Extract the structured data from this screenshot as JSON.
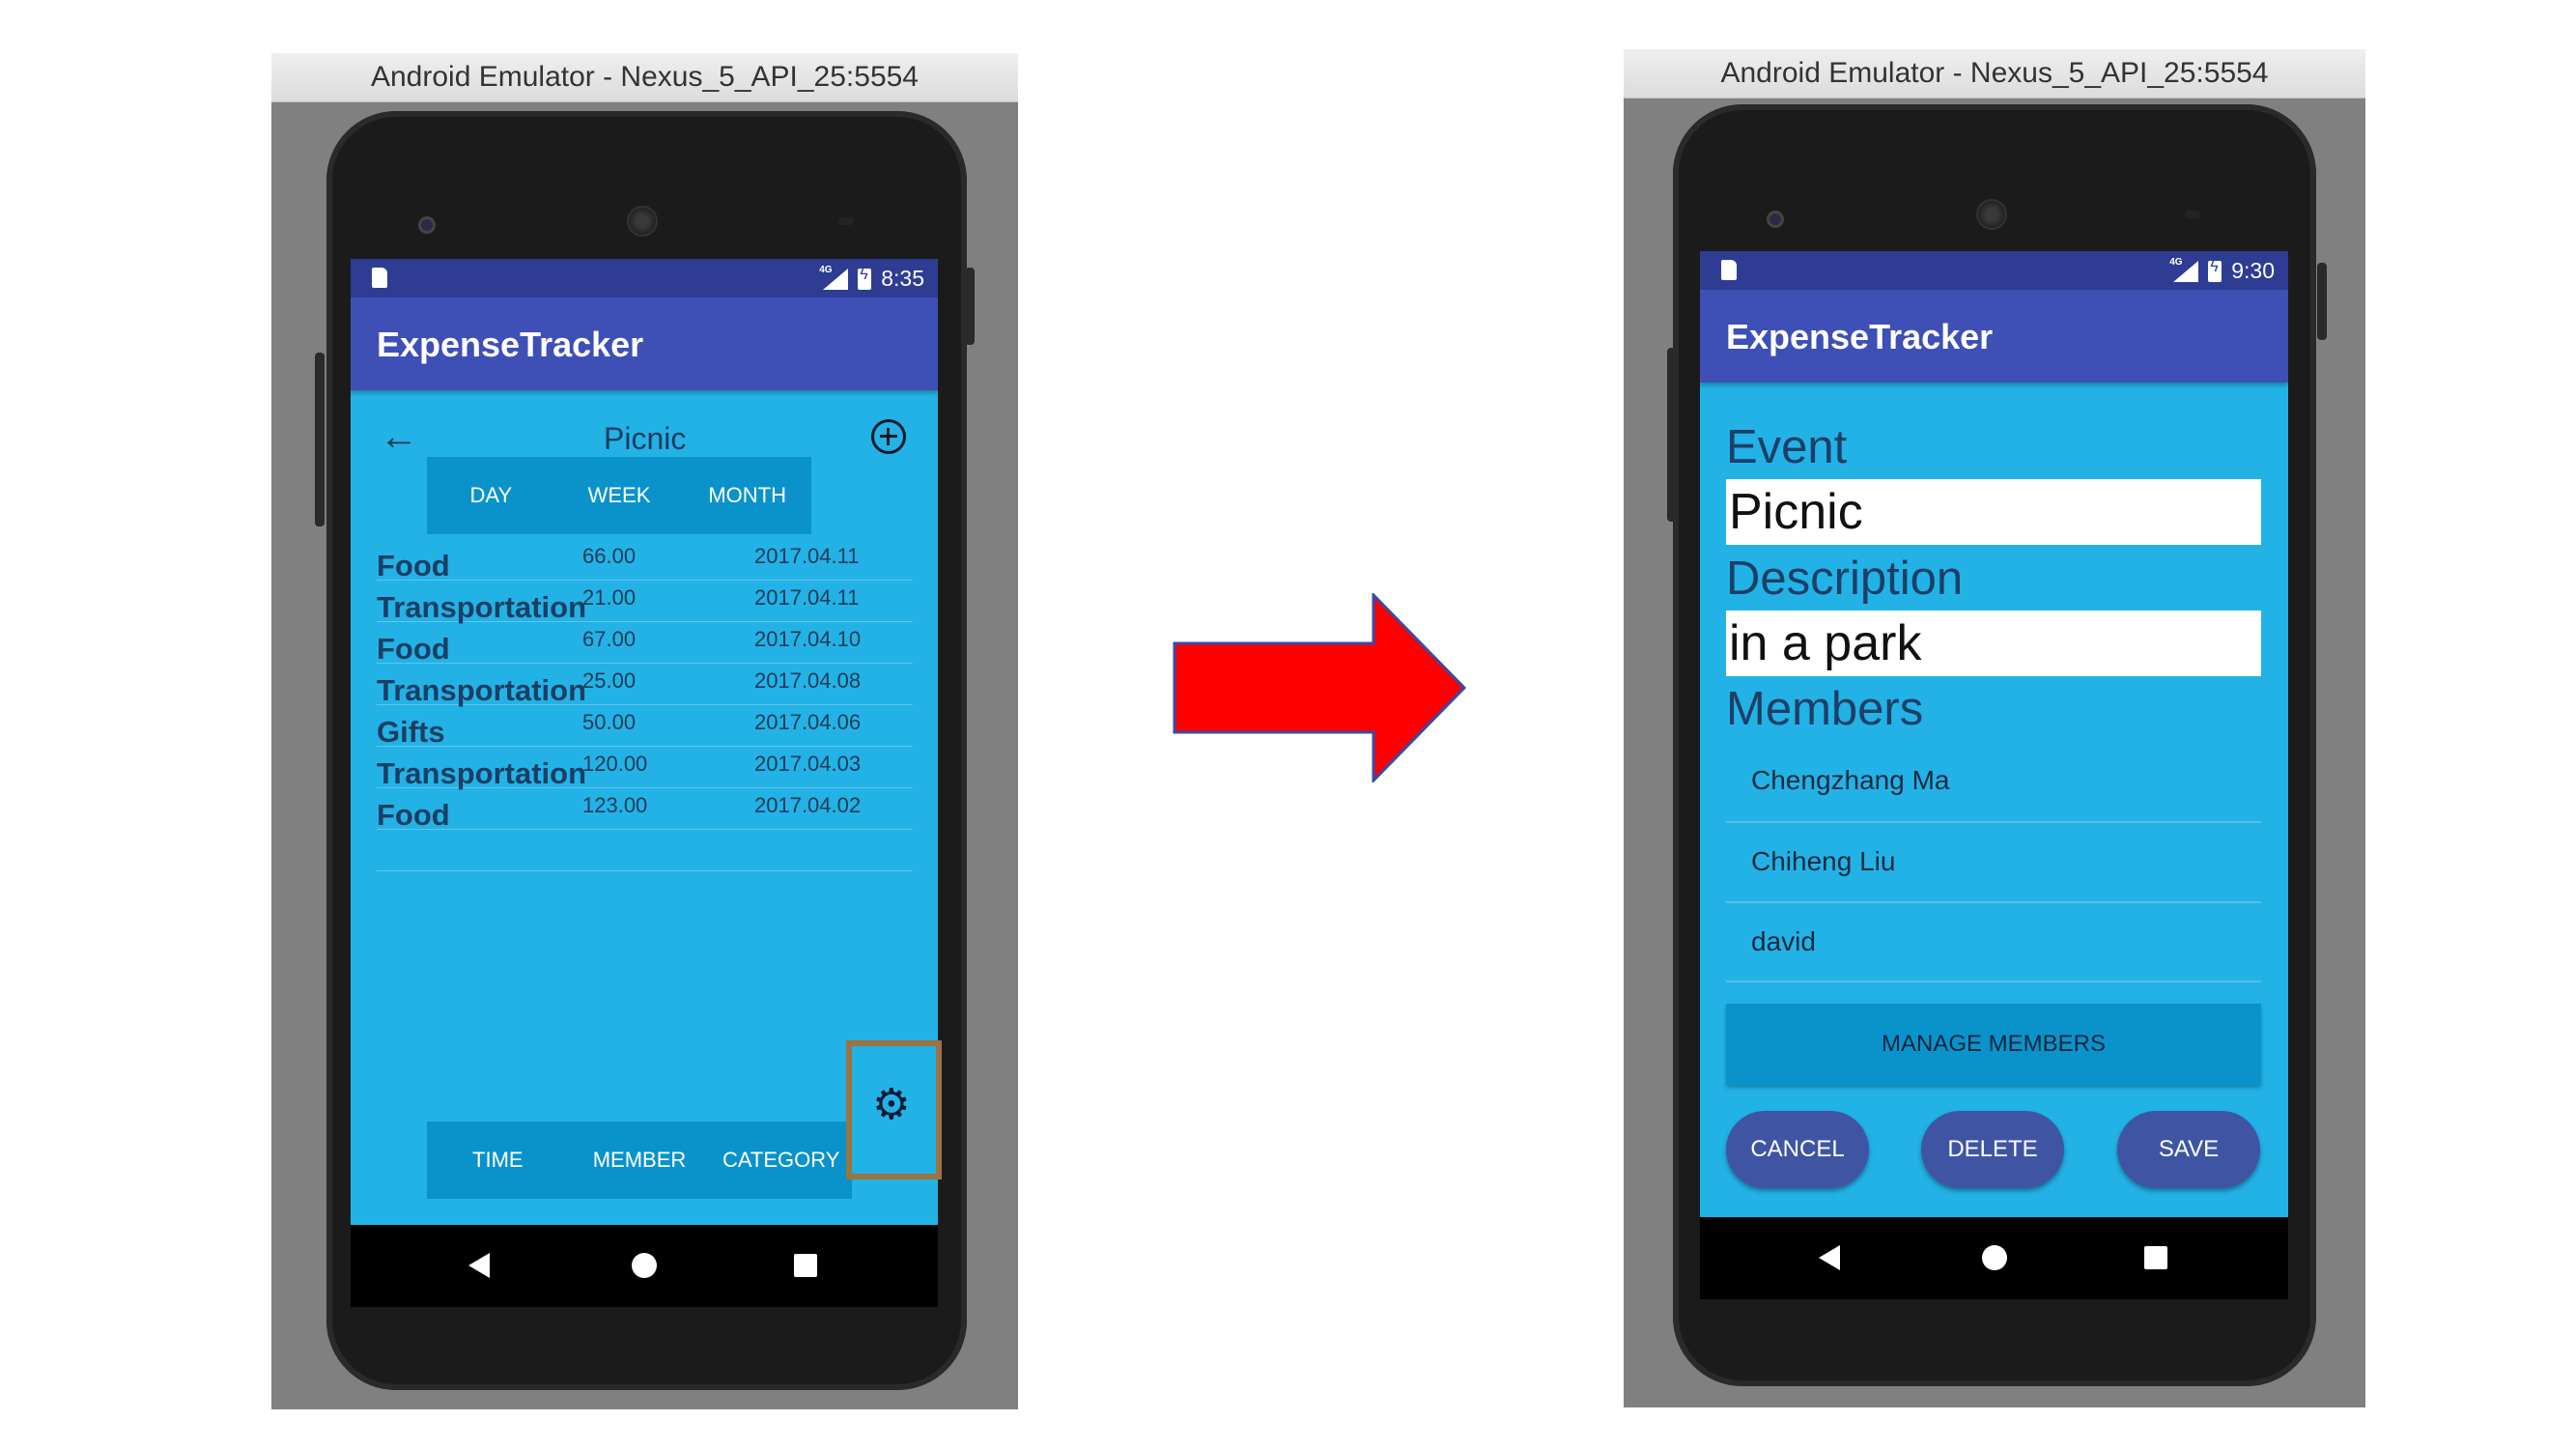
{
  "left": {
    "emulator_title": "Android Emulator - Nexus_5_API_25:5554",
    "status_time": "8:35",
    "network": "4G",
    "app_title": "ExpenseTracker",
    "event_title": "Picnic",
    "tabs": [
      "DAY",
      "WEEK",
      "MONTH"
    ],
    "expenses": [
      {
        "category": "Food",
        "amount": "66.00",
        "date": "2017.04.11"
      },
      {
        "category": "Transportation",
        "amount": "21.00",
        "date": "2017.04.11"
      },
      {
        "category": "Food",
        "amount": "67.00",
        "date": "2017.04.10"
      },
      {
        "category": "Transportation",
        "amount": "25.00",
        "date": "2017.04.08"
      },
      {
        "category": "Gifts",
        "amount": "50.00",
        "date": "2017.04.06"
      },
      {
        "category": "Transportation",
        "amount": "120.00",
        "date": "2017.04.03"
      },
      {
        "category": "Food",
        "amount": "123.00",
        "date": "2017.04.02"
      }
    ],
    "bottom_tabs": [
      "TIME",
      "MEMBER",
      "CATEGORY"
    ],
    "icons": {
      "back": "arrow-left-icon",
      "add": "plus-circle-icon",
      "settings": "gear-icon"
    },
    "highlight_color": "#9a7443"
  },
  "right": {
    "emulator_title": "Android Emulator - Nexus_5_API_25:5554",
    "status_time": "9:30",
    "network": "4G",
    "app_title": "ExpenseTracker",
    "event_label": "Event",
    "event_value": "Picnic",
    "description_label": "Description",
    "description_value": "in a park",
    "members_label": "Members",
    "members": [
      "Chengzhang Ma",
      "Chiheng Liu",
      "david"
    ],
    "manage_members_label": "MANAGE MEMBERS",
    "cancel_label": "CANCEL",
    "delete_label": "DELETE",
    "save_label": "SAVE"
  },
  "colors": {
    "screen_bg": "#22b2e6",
    "appbar": "#3e4fb5",
    "statusbar": "#2e3c94",
    "tab_bg": "#0a93cb",
    "pill_button": "#3f55a4",
    "arrow": "#ff0000"
  }
}
